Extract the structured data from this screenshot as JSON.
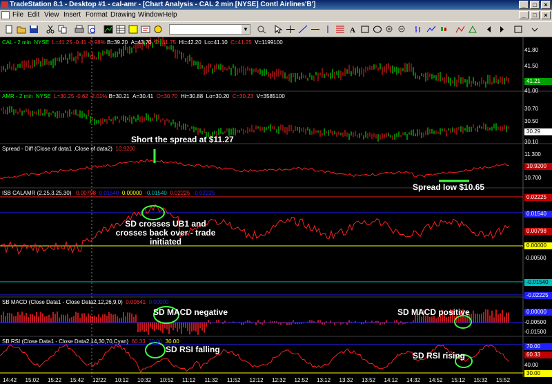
{
  "window": {
    "title": "TradeStation 8.1 - Desktop #1 - cal-amr - [Chart Analysis - CAL  2 min  [NYSE] Contl Airlines'B']"
  },
  "menu": [
    "File",
    "Edit",
    "View",
    "Insert",
    "Format",
    "Drawing",
    "Window",
    "Help"
  ],
  "colors": {
    "green": "#00ff00",
    "red": "#ff2020",
    "blue": "#2020ff",
    "yellow": "#ffff00",
    "cyan": "#00c0c0",
    "white": "#ffffff",
    "lime": "#40ff40",
    "darkred": "#c00000"
  },
  "panes": {
    "cal": {
      "sym": "CAL - 2 min",
      "ex": "NYSE",
      "L": "L=41.25",
      "chg": "-0.41",
      "pct": "-0.98%",
      "B": "B=39.20",
      "A": "A=43.70",
      "O": "O=41.75",
      "Hi": "Hi=42.20",
      "Lo": "Lo=41.10",
      "C": "C=41.25",
      "V": "V=1199100",
      "axis": [
        "41.80",
        "41.50",
        "41.21",
        "41.00"
      ]
    },
    "amr": {
      "sym": "AMR - 2 min",
      "ex": "NYSE",
      "L": "L=30.25",
      "chg": "-0.62",
      "pct": "-2.01%",
      "B": "B=30.21",
      "A": "A=30.41",
      "O": "O=30.70",
      "Hi": "Hi=30.88",
      "Lo": "Lo=30.20",
      "C": "C=30.23",
      "V": "V=3585100",
      "axis": [
        "30.70",
        "30.50",
        "30.29",
        "30.10"
      ]
    },
    "spread": {
      "label": "Spread - Diff  (Close of data1 ,Close of data2)",
      "val": "10.9200",
      "axis": [
        "11.300",
        "10.9200",
        "10.700"
      ]
    },
    "isb": {
      "label": "ISB CALAMR  (2.25,3.25,30)",
      "v1": "0.00798",
      "v2": "0.01540",
      "v3": "0.00000",
      "v4": "-0.01540",
      "v5": "0.02225",
      "v6": "-0.02225",
      "axis": [
        "0.02225",
        "0.01540",
        "0.00798",
        "0.00000",
        "-0.00500",
        "-0.01540",
        "-0.02225"
      ]
    },
    "macd": {
      "label": "SB MACD  (Close Data1 - Close Data2,12,26,9,0)",
      "v1": "0.00841",
      "v2": "0.00000",
      "axis": [
        "0.00000",
        "-0.00500",
        "-0.01500"
      ]
    },
    "rsi": {
      "label": "SB RSI  (Close Data1 - Close Data2,14,30,70,Cyan)",
      "v1": "60.33",
      "v2": "70.00",
      "v3": "30.00",
      "axis": [
        "70.00",
        "60.33",
        "40.00",
        "30.00"
      ]
    }
  },
  "annotations": {
    "short": "Short the spread at $11.27",
    "low": "Spread low $10.65",
    "sd_cross": "SD crosses UB1 and crosses back over - trade initiated",
    "macd_neg": "SD MACD negative",
    "macd_pos": "SD MACD positive",
    "rsi_fall": "SD RSI falling",
    "rsi_rise": "SD RSI rising"
  },
  "time_axis": [
    "14:42",
    "15:02",
    "15:22",
    "15:42",
    "12/22",
    "10:12",
    "10:32",
    "10:52",
    "11:12",
    "11:32",
    "11:52",
    "12:12",
    "12:32",
    "12:52",
    "13:12",
    "13:32",
    "13:52",
    "14:12",
    "14:32",
    "14:52",
    "15:12",
    "15:32",
    "15:52"
  ]
}
